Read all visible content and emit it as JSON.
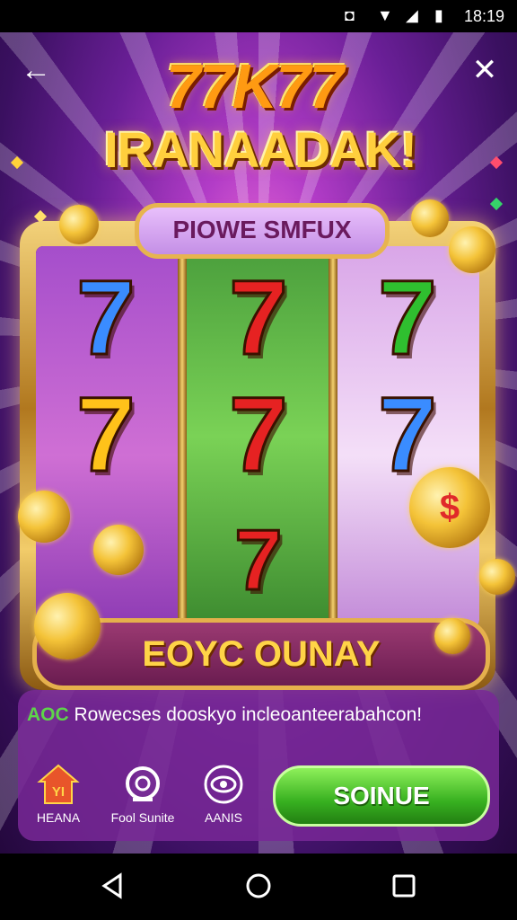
{
  "status_bar": {
    "time": "18:19"
  },
  "header": {
    "title_numbers": "77K77",
    "title_word": "IRANAADAK!"
  },
  "machine": {
    "top_banner": "PIOWE SMFUX",
    "bottom_banner": "EOYC OUNAY",
    "reels": [
      {
        "symbols": [
          "7",
          "7"
        ],
        "colors": [
          "blue",
          "yellow"
        ]
      },
      {
        "symbols": [
          "7",
          "7",
          "7"
        ],
        "colors": [
          "red",
          "red",
          "red"
        ]
      },
      {
        "symbols": [
          "7",
          "7"
        ],
        "colors": [
          "green",
          "blue"
        ]
      }
    ]
  },
  "panel": {
    "message_tag": "AOC",
    "message_text": "Rowecses dooskyo incleoanteerabahcon!",
    "nav": [
      {
        "label": "HEANA",
        "icon": "home-icon",
        "badge": "YI"
      },
      {
        "label": "Fool Sunite",
        "icon": "search-icon"
      },
      {
        "label": "AANIS",
        "icon": "eye-icon"
      }
    ],
    "cta_label": "SOINUE"
  },
  "colors": {
    "cta_green": "#37b020",
    "gold": "#f4c338",
    "panel_purple": "#782896"
  }
}
